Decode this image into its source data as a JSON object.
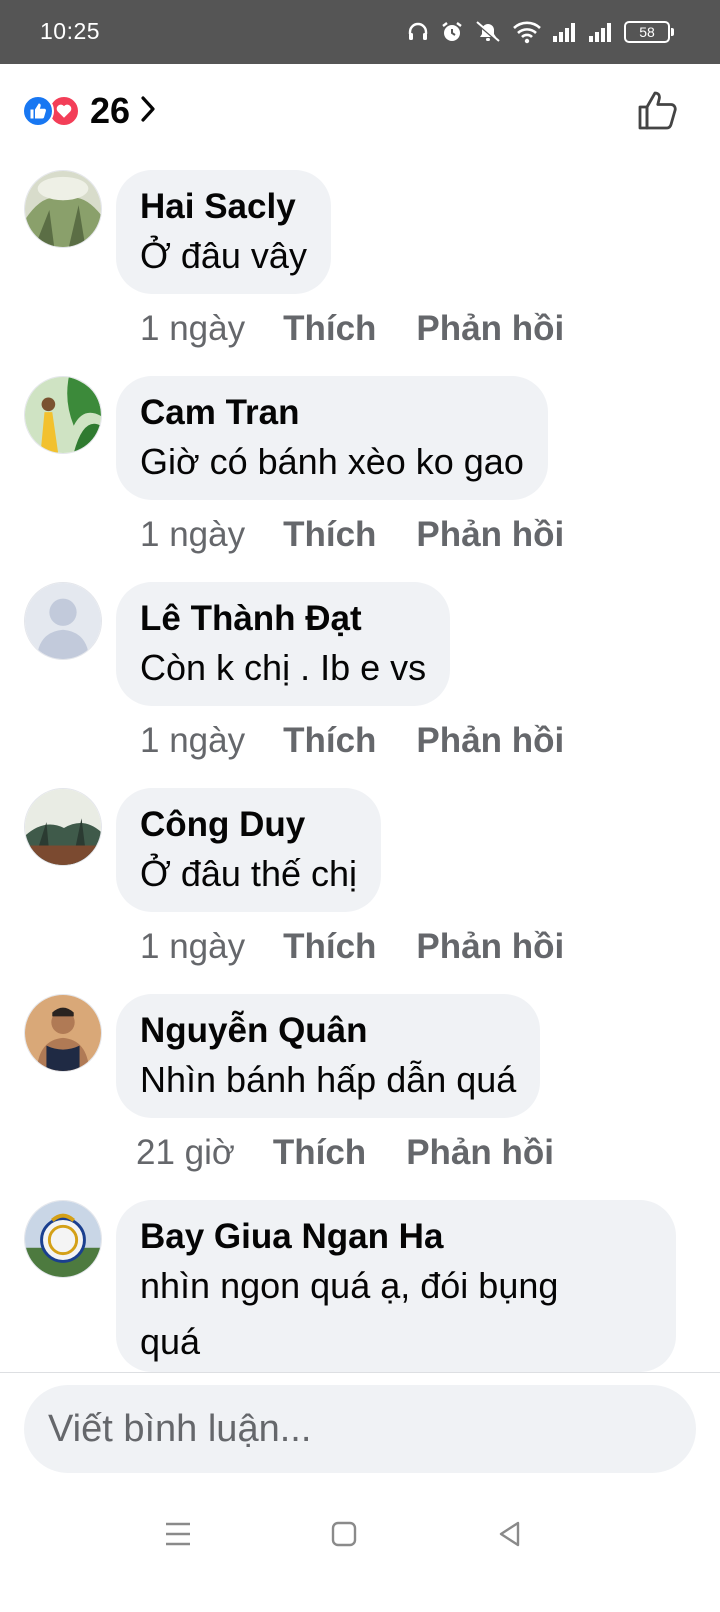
{
  "status_bar": {
    "time": "10:25",
    "battery": "58",
    "icons": [
      "headphones-icon",
      "alarm-icon",
      "mute-icon",
      "wifi-icon",
      "signal-icon",
      "signal-icon",
      "battery-icon"
    ]
  },
  "reactions": {
    "count": "26",
    "types": [
      "like",
      "love"
    ],
    "like_color": "#1877f2",
    "love_color": "#f33e58"
  },
  "comments": [
    {
      "author": "Hai Sacly",
      "text": [
        "Ở đâu vây"
      ],
      "time": "1 ngày",
      "like_label": "Thích",
      "reply_label": "Phản hồi"
    },
    {
      "author": "Cam Tran",
      "text": [
        "Giờ có bánh xèo ko gao"
      ],
      "time": "1 ngày",
      "like_label": "Thích",
      "reply_label": "Phản hồi"
    },
    {
      "author": "Lê Thành Đạt",
      "text": [
        "Còn k chị . Ib e vs"
      ],
      "time": "1 ngày",
      "like_label": "Thích",
      "reply_label": "Phản hồi"
    },
    {
      "author": "Công Duy",
      "text": [
        "Ở đâu thế chị"
      ],
      "time": "1 ngày",
      "like_label": "Thích",
      "reply_label": "Phản hồi"
    },
    {
      "author": "Nguyễn Quân",
      "text": [
        "Nhìn bánh hấp dẫn quá"
      ],
      "time": "21 giờ",
      "like_label": "Thích",
      "reply_label": "Phản hồi"
    },
    {
      "author": "Bay Giua Ngan Ha",
      "text": [
        "nhìn ngon quá ạ, đói bụng",
        "quá"
      ]
    }
  ],
  "composer": {
    "placeholder": "Viết bình luận..."
  },
  "nav": {
    "icons": [
      "menu-icon",
      "home-icon",
      "back-icon"
    ]
  }
}
